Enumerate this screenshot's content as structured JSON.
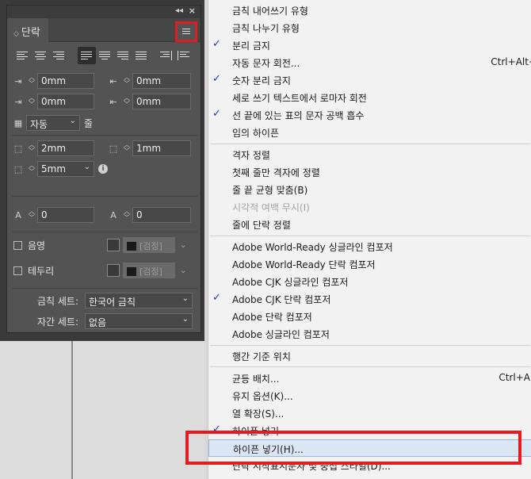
{
  "panel": {
    "tab_label": "단락",
    "indents": {
      "left": "0mm",
      "right": "0mm",
      "first_line": "0mm",
      "last_line": "0mm"
    },
    "grid_align_value": "자동",
    "grid_align_unit": "줄",
    "space": {
      "before": "2mm",
      "after": "1mm",
      "drop": "5mm"
    },
    "drop_cap": {
      "lines": "0",
      "chars": "0"
    },
    "shading_label": "음영",
    "shading_color": "[검정]",
    "border_label": "테두리",
    "border_color": "[검정]",
    "kinsoku_label": "금칙 세트:",
    "kinsoku_value": "한국어 금칙",
    "mojikumi_label": "자간 세트:",
    "mojikumi_value": "없음"
  },
  "menu": {
    "items": [
      {
        "label": "금칙 내어쓰기 유형",
        "checked": false,
        "shortcut": "",
        "disabled": false
      },
      {
        "label": "금칙 나누기 유형",
        "checked": false,
        "shortcut": "",
        "disabled": false
      },
      {
        "label": "분리 금지",
        "checked": true,
        "shortcut": "",
        "disabled": false
      },
      {
        "label": "자동 문자 회전...",
        "checked": false,
        "shortcut": "Ctrl+Alt+",
        "disabled": false
      },
      {
        "label": "숫자 분리 금지",
        "checked": true,
        "shortcut": "",
        "disabled": false
      },
      {
        "label": "세로 쓰기 텍스트에서 로마자 회전",
        "checked": false,
        "shortcut": "",
        "disabled": false
      },
      {
        "label": "선 끝에 있는 표의 문자 공백 흡수",
        "checked": true,
        "shortcut": "",
        "disabled": false
      },
      {
        "label": "임의 하이픈",
        "checked": false,
        "shortcut": "",
        "disabled": false
      },
      {
        "label": "격자 정렬",
        "checked": false,
        "shortcut": "",
        "disabled": false
      },
      {
        "label": "첫째 줄만 격자에 정렬",
        "checked": false,
        "shortcut": "",
        "disabled": false
      },
      {
        "label": "줄 끝 균형 맞춤(B)",
        "checked": false,
        "shortcut": "",
        "disabled": false
      },
      {
        "label": "시각적 여백 무시(I)",
        "checked": false,
        "shortcut": "",
        "disabled": true
      },
      {
        "label": "줄에 단락 정렬",
        "checked": false,
        "shortcut": "",
        "disabled": false
      },
      {
        "label": "Adobe World-Ready 싱글라인 컴포저",
        "checked": false,
        "shortcut": "",
        "disabled": false
      },
      {
        "label": "Adobe World-Ready 단락 컴포저",
        "checked": false,
        "shortcut": "",
        "disabled": false
      },
      {
        "label": "Adobe CJK 싱글라인 컴포저",
        "checked": false,
        "shortcut": "",
        "disabled": false
      },
      {
        "label": "Adobe CJK 단락 컴포저",
        "checked": true,
        "shortcut": "",
        "disabled": false
      },
      {
        "label": "Adobe 단락 컴포저",
        "checked": false,
        "shortcut": "",
        "disabled": false
      },
      {
        "label": "Adobe 싱글라인 컴포저",
        "checked": false,
        "shortcut": "",
        "disabled": false
      },
      {
        "label": "행간 기준 위치",
        "checked": false,
        "shortcut": "",
        "disabled": false
      },
      {
        "label": "균등 배치...",
        "checked": false,
        "shortcut": "Ctrl+Alt",
        "disabled": false
      },
      {
        "label": "유지 옵션(K)...",
        "checked": false,
        "shortcut": "",
        "disabled": false
      },
      {
        "label": "열 확장(S)...",
        "checked": false,
        "shortcut": "",
        "disabled": false
      },
      {
        "label": "하이픈 넣기",
        "checked": true,
        "shortcut": "",
        "disabled": false
      },
      {
        "label": "하이픈 넣기(H)...",
        "checked": false,
        "shortcut": "",
        "disabled": false,
        "highlighted": true
      },
      {
        "label": "단락 시작표시문자 및 중첩 스타일(D)...",
        "checked": false,
        "shortcut": "",
        "disabled": false
      }
    ]
  }
}
